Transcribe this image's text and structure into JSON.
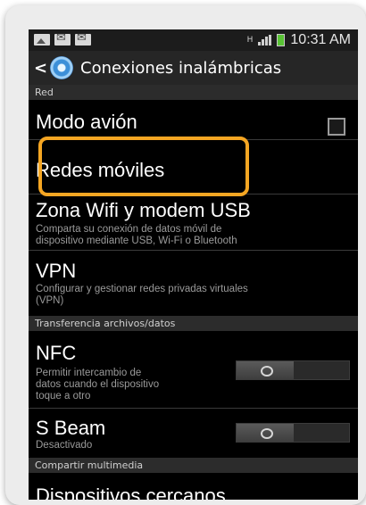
{
  "status_bar": {
    "time": "10:31 AM",
    "network_letter": "H",
    "icons": [
      "image-icon",
      "message-icon",
      "message-icon",
      "signal-icon",
      "battery-icon"
    ],
    "battery_color": "#58c234"
  },
  "action_bar": {
    "back_glyph": "<",
    "title": "Conexiones inalámbricas"
  },
  "sections": {
    "red": "Red",
    "transferencia": "Transferencia archivos/datos",
    "compartir": "Compartir multimedia"
  },
  "items": {
    "modo_avion": {
      "title": "Modo avión",
      "checked": false
    },
    "redes_moviles": {
      "title": "Redes móviles"
    },
    "zona_wifi": {
      "title": "Zona Wifi y modem USB",
      "summary": "Comparta su conexión de datos móvil de\ndispositivo mediante USB, Wi-Fi o Bluetooth"
    },
    "vpn": {
      "title": "VPN",
      "summary": "Configurar y gestionar redes privadas virtuales\n(VPN)"
    },
    "nfc": {
      "title": "NFC",
      "summary": "Permitir intercambio de\ndatos cuando el dispositivo\ntoque a otro",
      "enabled": false
    },
    "s_beam": {
      "title": "S Beam",
      "summary": "Desactivado",
      "enabled": false
    },
    "dispositivos": {
      "title": "Dispositivos cercanos"
    }
  },
  "colors": {
    "highlight": "#f5a623",
    "background": "#000000",
    "section_bg": "#2c2c2c"
  }
}
